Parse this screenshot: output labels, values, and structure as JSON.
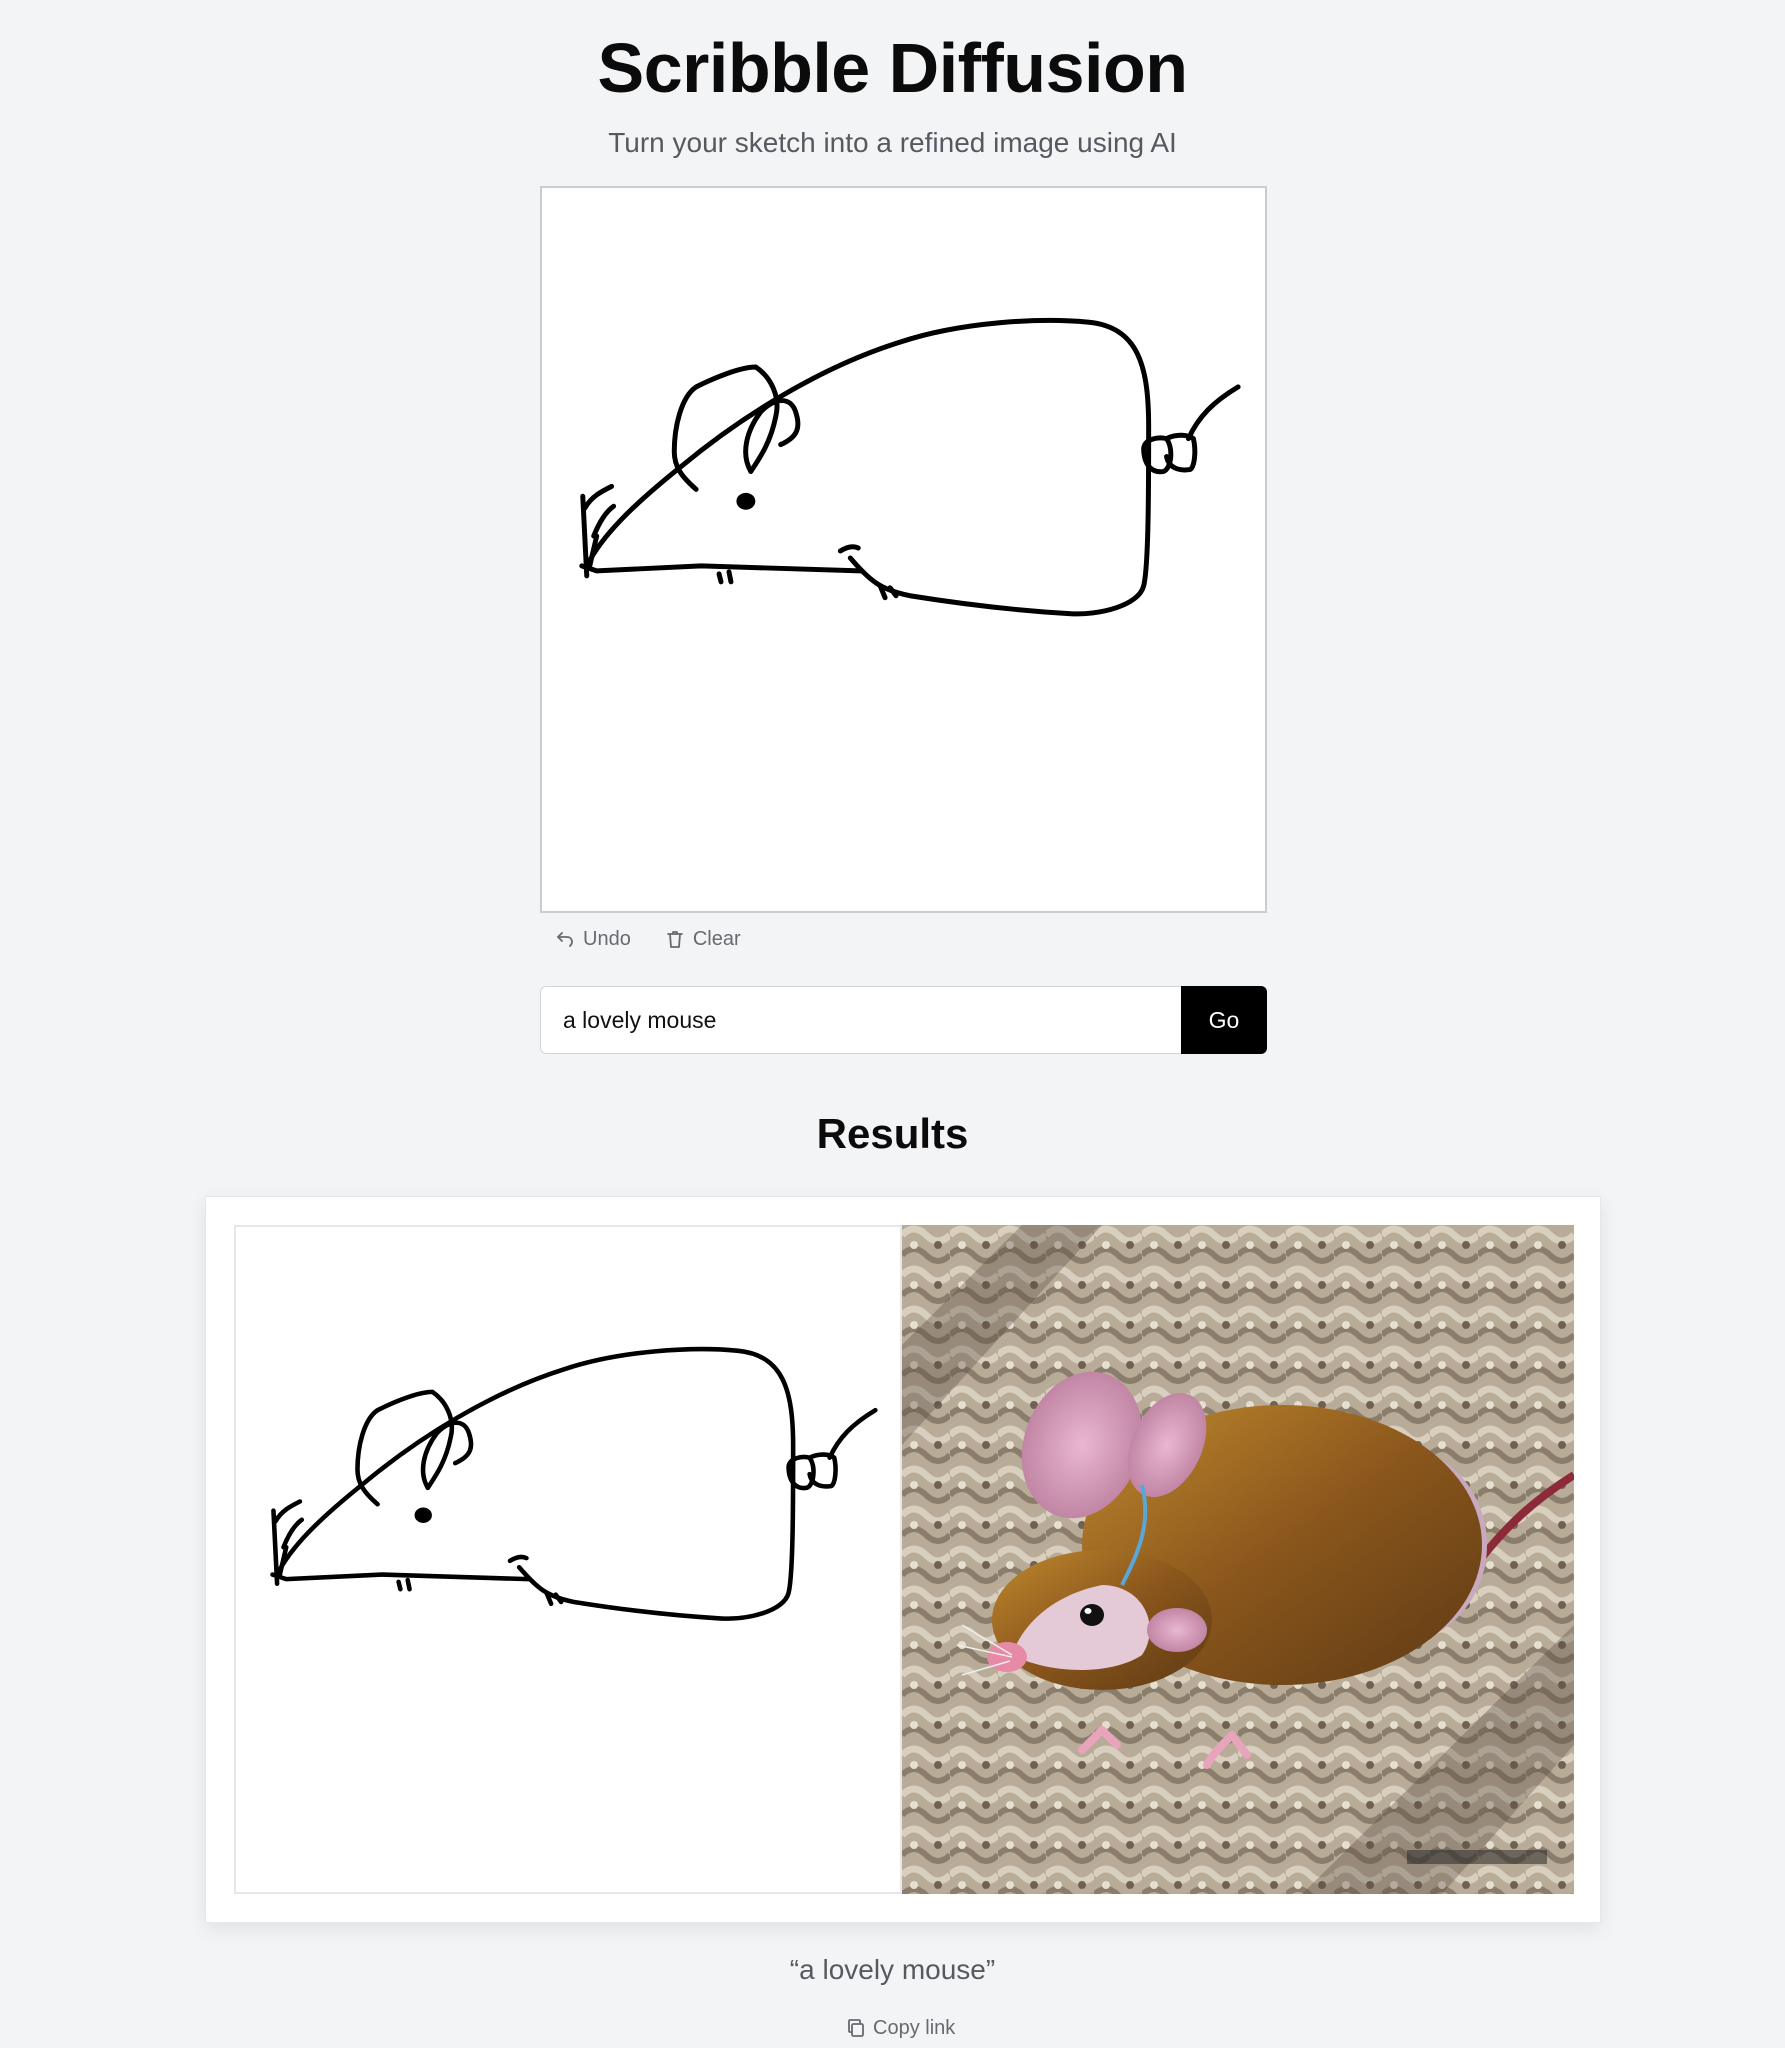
{
  "header": {
    "title": "Scribble Diffusion",
    "subtitle": "Turn your sketch into a refined image using AI"
  },
  "toolbar": {
    "undo_icon": "undo-icon",
    "undo_label": "Undo",
    "clear_icon": "trash-icon",
    "clear_label": "Clear"
  },
  "prompt": {
    "value": "a lovely mouse",
    "go_label": "Go"
  },
  "results": {
    "heading": "Results",
    "items": [
      {
        "caption": "“a lovely mouse”",
        "copy_icon": "copy-icon",
        "copy_label": "Copy link"
      }
    ]
  },
  "colors": {
    "background": "#f3f4f6",
    "button_bg": "#000000",
    "button_text": "#ffffff",
    "stroke": "#000000",
    "muted_text": "#666b71"
  }
}
